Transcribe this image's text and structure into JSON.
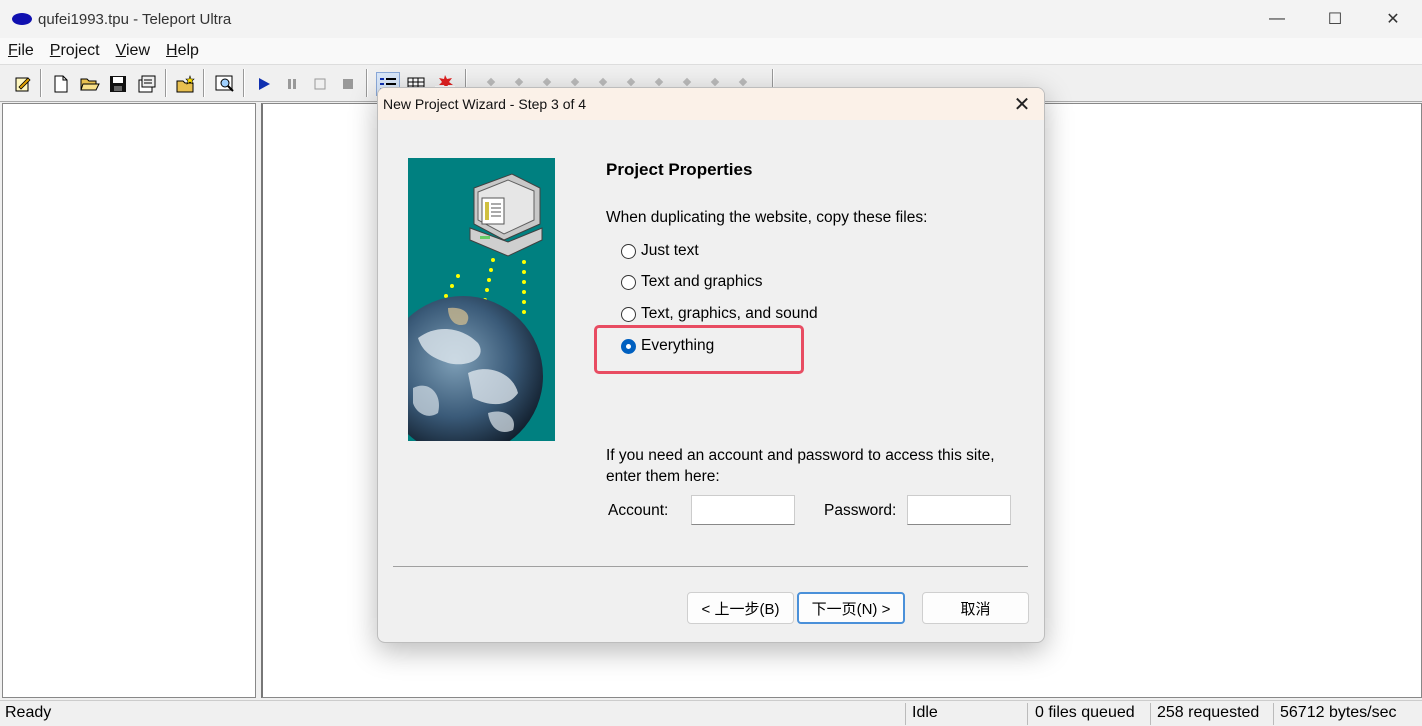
{
  "window": {
    "title": "qufei1993.tpu - Teleport Ultra",
    "controls": {
      "minimize": "—",
      "maximize": "☐",
      "close": "✕"
    }
  },
  "menu": {
    "items": [
      {
        "underline": "F",
        "rest": "ile"
      },
      {
        "underline": "P",
        "rest": "roject"
      },
      {
        "underline": "V",
        "rest": "iew"
      },
      {
        "underline": "H",
        "rest": "elp"
      }
    ]
  },
  "toolbar": {
    "icons": [
      "new-project-wizard-icon",
      "new-icon",
      "open-icon",
      "save-icon",
      "properties-icon",
      "new-folder-icon",
      "find-icon",
      "start-icon",
      "pause-icon",
      "stop-icon",
      "stop-all-icon",
      "details-view-icon",
      "list-view-icon",
      "new-items-icon"
    ]
  },
  "dialog": {
    "title": "New Project Wizard - Step 3 of 4",
    "close_glyph": "✕",
    "heading": "Project Properties",
    "instruction": "When duplicating the website, copy these files:",
    "options": [
      {
        "label": "Just text",
        "selected": false
      },
      {
        "label": "Text and graphics",
        "selected": false
      },
      {
        "label": "Text, graphics, and sound",
        "selected": false
      },
      {
        "label": "Everything",
        "selected": true
      }
    ],
    "account_note": "If you need an account and password to access this site, enter them here:",
    "account_label": "Account:",
    "account_value": "",
    "password_label": "Password:",
    "password_value": "",
    "buttons": {
      "back": "< 上一步(B)",
      "next": "下一页(N) >",
      "cancel": "取消"
    },
    "highlight_color": "#e84c62"
  },
  "statusbar": {
    "state": "Ready",
    "activity": "Idle",
    "queued": "0 files queued",
    "requested": "258 requested",
    "rate": "56712 bytes/sec"
  }
}
